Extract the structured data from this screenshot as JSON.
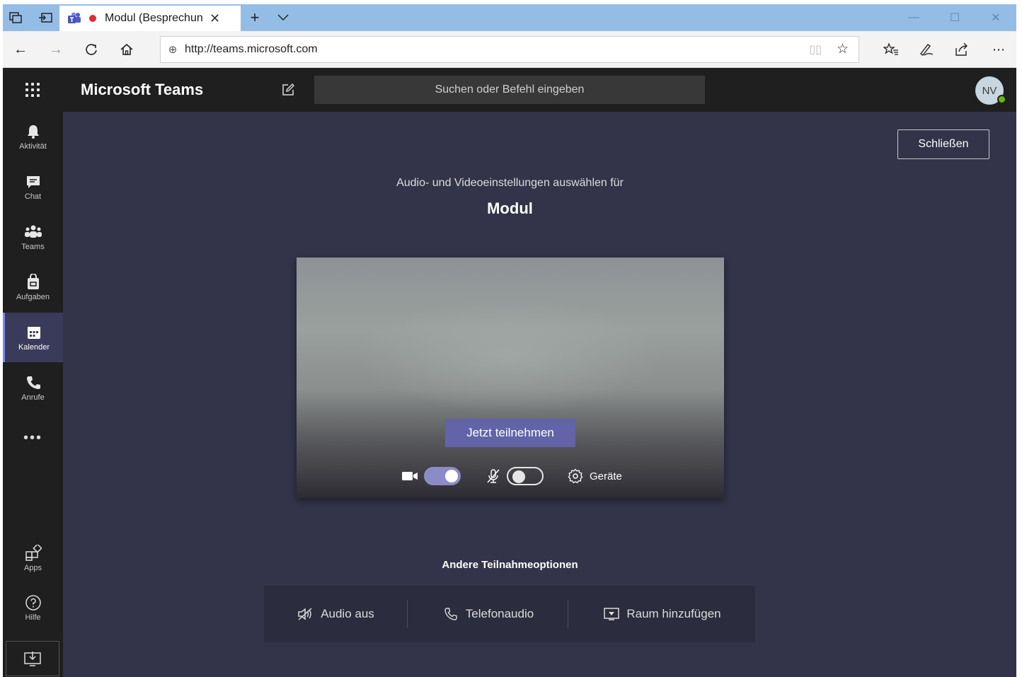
{
  "browser": {
    "tab_title": "Modul (Besprechun",
    "url": "http://teams.microsoft.com"
  },
  "header": {
    "app_title": "Microsoft Teams",
    "search_placeholder": "Suchen oder Befehl eingeben",
    "avatar_initials": "NV"
  },
  "rail": {
    "items": [
      {
        "label": "Aktivität",
        "icon": "bell-icon"
      },
      {
        "label": "Chat",
        "icon": "chat-icon"
      },
      {
        "label": "Teams",
        "icon": "teams-icon"
      },
      {
        "label": "Aufgaben",
        "icon": "tasks-icon"
      },
      {
        "label": "Kalender",
        "icon": "calendar-icon",
        "active": true
      },
      {
        "label": "Anrufe",
        "icon": "phone-icon"
      }
    ],
    "more": "•••",
    "apps_label": "Apps",
    "help_label": "Hilfe"
  },
  "main": {
    "close_label": "Schließen",
    "subtitle": "Audio- und Videoeinstellungen auswählen für",
    "meeting_title": "Modul",
    "join_label": "Jetzt teilnehmen",
    "camera_on": true,
    "mic_on": false,
    "devices_label": "Geräte",
    "other_options_title": "Andere Teilnahmeoptionen",
    "options": [
      {
        "label": "Audio aus",
        "icon": "speaker-off-icon"
      },
      {
        "label": "Telefonaudio",
        "icon": "phone-icon"
      },
      {
        "label": "Raum hinzufügen",
        "icon": "room-icon"
      }
    ]
  },
  "colors": {
    "accent": "#6264a7",
    "rail_bg": "#1f1f1f",
    "main_bg": "#33344a",
    "presence": "#6bb700"
  }
}
